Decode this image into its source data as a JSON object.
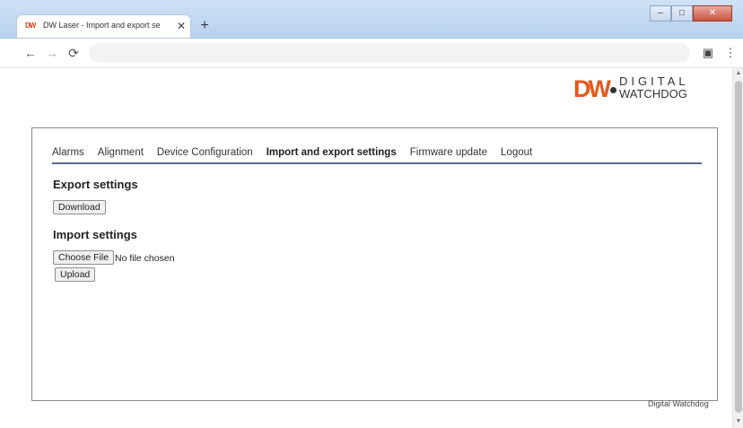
{
  "browser": {
    "tab_title": "DW Laser - Import and export se",
    "favicon_text": "DW",
    "close_tab_glyph": "✕",
    "new_tab_glyph": "+",
    "nav": {
      "back_icon": "back-arrow-icon",
      "forward_icon": "forward-arrow-icon",
      "reload_icon": "reload-icon"
    },
    "address": "",
    "window_controls": [
      "minimize",
      "maximize",
      "close"
    ]
  },
  "logo": {
    "brand": "DW",
    "line1": "DIGITAL",
    "line2": "WATCHDOG"
  },
  "menu": {
    "items": [
      {
        "label": "Alarms",
        "active": false
      },
      {
        "label": "Alignment",
        "active": false
      },
      {
        "label": "Device Configuration",
        "active": false
      },
      {
        "label": "Import and export settings",
        "active": true
      },
      {
        "label": "Firmware update",
        "active": false
      },
      {
        "label": "Logout",
        "active": false
      }
    ]
  },
  "export": {
    "title": "Export settings",
    "download_label": "Download"
  },
  "import": {
    "title": "Import settings",
    "choose_file_label": "Choose File",
    "file_status": "No file chosen",
    "upload_label": "Upload"
  },
  "footer": {
    "text": "Digital Watchdog"
  },
  "colors": {
    "brand_orange": "#e35a1a",
    "menu_underline": "#5b6a8d"
  }
}
